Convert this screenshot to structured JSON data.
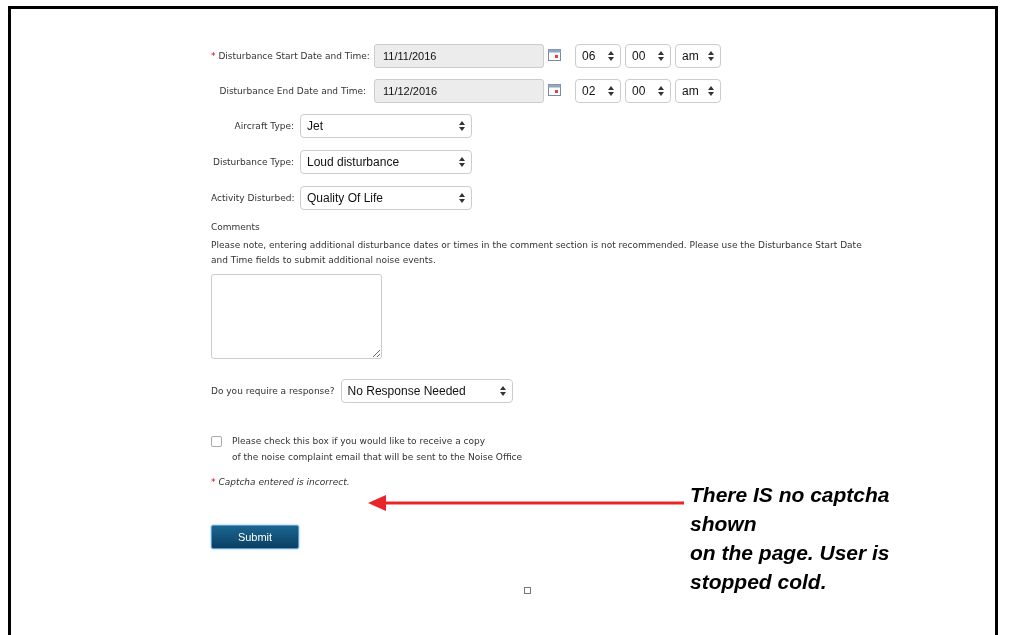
{
  "form": {
    "date_rows": [
      {
        "marker": "*",
        "label": "Disturbance Start Date and Time:",
        "date": "11/11/2016",
        "hour": "06",
        "minute": "00",
        "period": "am"
      },
      {
        "label": "Disturbance End Date and Time:",
        "date": "11/12/2016",
        "hour": "02",
        "minute": "00",
        "period": "am"
      }
    ],
    "select_rows": [
      {
        "label": "Aircraft Type:",
        "value": "Jet"
      },
      {
        "label": "Disturbance Type:",
        "value": "Loud disturbance"
      },
      {
        "label": "Activity Disturbed:",
        "value": "Quality Of Life"
      }
    ],
    "comments": {
      "label": "Comments",
      "note": "Please note, entering additional disturbance dates or times in the comment section is not recommended. Please use the Disturbance Start Date and Time fields to submit additional noise events."
    },
    "response": {
      "label": "Do you require a response?",
      "value": "No Response Needed"
    },
    "copy_checkbox": {
      "checked": false,
      "lines": [
        "Please check this box if you would like to receive a copy",
        "of the noise complaint email that will be sent to the Noise Office"
      ]
    },
    "error": {
      "marker": "*",
      "text": "Captcha entered is incorrect."
    },
    "submit": "Submit"
  },
  "annotation": {
    "lines": [
      "There IS no captcha",
      "shown",
      "on the page. User is",
      "stopped cold."
    ]
  }
}
